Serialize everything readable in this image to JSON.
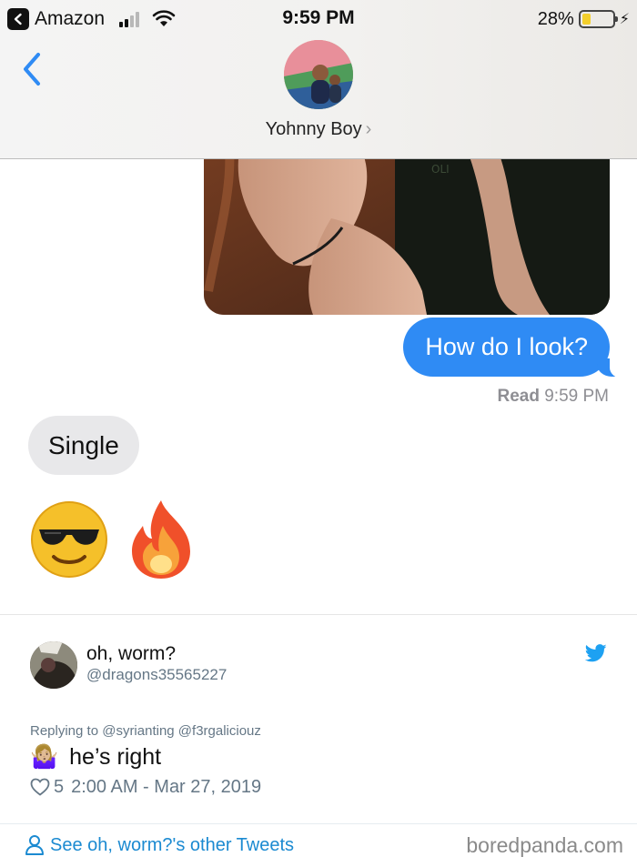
{
  "status_bar": {
    "back_app": "Amazon",
    "time": "9:59 PM",
    "battery_percent": "28%",
    "battery_level": 0.28,
    "signal_bars_active": 2,
    "signal_bars_total": 4
  },
  "conversation": {
    "contact_name": "Yohnny Boy",
    "outgoing_message": "How do I look?",
    "read_label": "Read",
    "read_time": "9:59 PM",
    "incoming_message": "Single",
    "incoming_emojis": [
      "😎",
      "🔥"
    ],
    "colors": {
      "outgoing_bubble": "#2f8bf4",
      "incoming_bubble": "#e8e8ea"
    }
  },
  "tweet": {
    "display_name": "oh, worm?",
    "handle": "@dragons35565227",
    "replying_to": "Replying to @syrianting @f3rgaliciouz",
    "text_emoji": "🤷🏼‍♀️",
    "text": "he’s right",
    "likes": "5",
    "timestamp": "2:00 AM - Mar 27, 2019",
    "more_link": "See oh, worm?'s other Tweets",
    "accent_color": "#1b8ad1"
  },
  "watermark": "boredpanda.com"
}
